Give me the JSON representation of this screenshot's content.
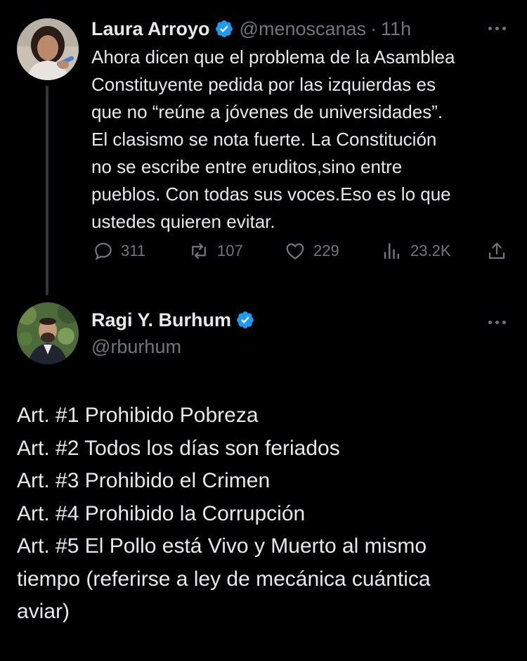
{
  "tweets": [
    {
      "name": "Laura Arroyo",
      "handle": "@menoscanas",
      "separator": "·",
      "time": "11h",
      "lines": [
        "Ahora dicen que el problema de la Asamblea",
        "Constituyente pedida por las izquierdas es",
        "que no “reúne a jóvenes de universidades”.",
        "El clasismo se nota fuerte. La Constitución",
        "no se escribe entre eruditos,sino entre",
        "pueblos. Con todas sus voces.Eso es lo que",
        "ustedes quieren evitar."
      ],
      "stats": {
        "replies": "311",
        "reposts": "107",
        "likes": "229",
        "views": "23.2K"
      }
    },
    {
      "name": "Ragi Y. Burhum",
      "handle": "@rburhum",
      "lines": [
        "Art. #1 Prohibido Pobreza",
        "Art. #2 Todos los días son feriados",
        "Art. #3 Prohibido el Crimen",
        "Art. #4 Prohibido la Corrupción",
        "Art. #5 El Pollo está Vivo y Muerto al mismo",
        "tiempo (referirse a ley de mecánica cuántica",
        "aviar)"
      ]
    }
  ],
  "colors": {
    "background": "#000000",
    "text": "#e7e9ea",
    "muted": "#71767b",
    "verified": "#1d9bf0",
    "thread_line": "#333639"
  },
  "icons": [
    "verified-badge-icon",
    "more-options-icon",
    "reply-icon",
    "repost-icon",
    "like-icon",
    "views-icon",
    "share-icon"
  ]
}
